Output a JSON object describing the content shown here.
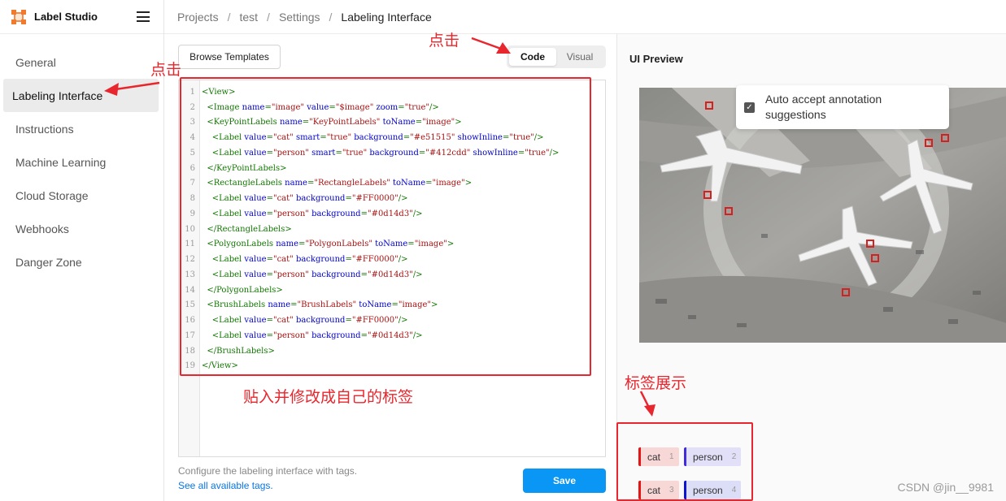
{
  "brand": {
    "name": "Label Studio",
    "logo_icon": "label-studio-logo-icon"
  },
  "breadcrumb": [
    "Projects",
    "test",
    "Settings",
    "Labeling Interface"
  ],
  "sidebar": {
    "items": [
      {
        "label": "General",
        "active": false
      },
      {
        "label": "Labeling Interface",
        "active": true
      },
      {
        "label": "Instructions",
        "active": false
      },
      {
        "label": "Machine Learning",
        "active": false
      },
      {
        "label": "Cloud Storage",
        "active": false
      },
      {
        "label": "Webhooks",
        "active": false
      },
      {
        "label": "Danger Zone",
        "active": false
      }
    ]
  },
  "editor": {
    "browse_templates": "Browse Templates",
    "tabs": {
      "code": "Code",
      "visual": "Visual",
      "active": "code"
    },
    "code_lines": [
      "<View>",
      "  <Image name=\"image\" value=\"$image\" zoom=\"true\"/>",
      "  <KeyPointLabels name=\"KeyPointLabels\" toName=\"image\">",
      "    <Label value=\"cat\" smart=\"true\" background=\"#e51515\" showInline=\"true\"/>",
      "    <Label value=\"person\" smart=\"true\" background=\"#412cdd\" showInline=\"true\"/>",
      "  </KeyPointLabels>",
      "  <RectangleLabels name=\"RectangleLabels\" toName=\"image\">",
      "    <Label value=\"cat\" background=\"#FF0000\"/>",
      "    <Label value=\"person\" background=\"#0d14d3\"/>",
      "  </RectangleLabels>",
      "  <PolygonLabels name=\"PolygonLabels\" toName=\"image\">",
      "    <Label value=\"cat\" background=\"#FF0000\"/>",
      "    <Label value=\"person\" background=\"#0d14d3\"/>",
      "  </PolygonLabels>",
      "  <BrushLabels name=\"BrushLabels\" toName=\"image\">",
      "    <Label value=\"cat\" background=\"#FF0000\"/>",
      "    <Label value=\"person\" background=\"#0d14d3\"/>",
      "  </BrushLabels>",
      "</View>"
    ],
    "hint": "Configure the labeling interface with tags.",
    "hint_link": "See all available tags.",
    "save": "Save"
  },
  "preview": {
    "title": "UI Preview",
    "auto_accept": "Auto accept annotation suggestions",
    "auto_accept_checked": true,
    "labels": [
      {
        "value": "cat",
        "hotkey": "1",
        "color": "#e51515"
      },
      {
        "value": "person",
        "hotkey": "2",
        "color": "#412cdd"
      },
      {
        "value": "cat",
        "hotkey": "3",
        "color": "#e51515"
      },
      {
        "value": "person",
        "hotkey": "4",
        "color": "#0d14d3"
      }
    ]
  },
  "annotations": {
    "click_sidebar": "点击",
    "click_code": "点击",
    "paste_modify": "贴入并修改成自己的标签",
    "label_display": "标签展示",
    "color": "#e8262d"
  },
  "watermark": "CSDN @jin__9981"
}
